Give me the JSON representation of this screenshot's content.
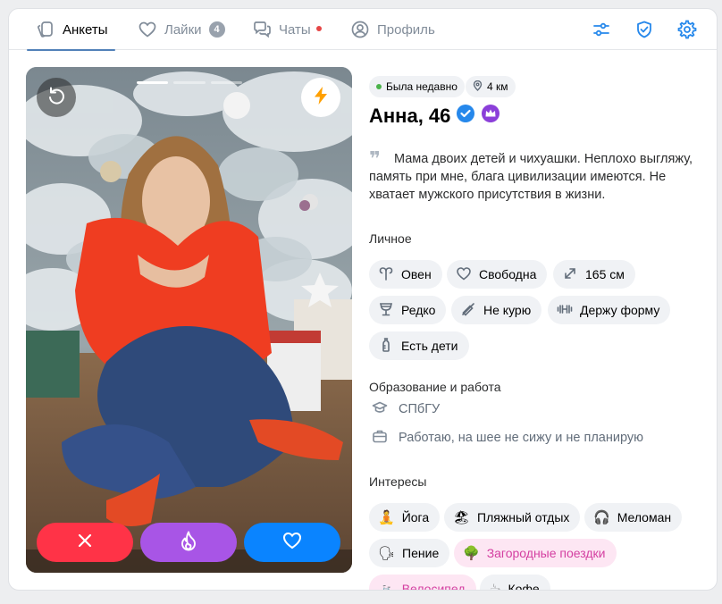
{
  "nav": {
    "tabs": [
      {
        "label": "Анкеты",
        "icon": "cards-icon",
        "active": true
      },
      {
        "label": "Лайки",
        "icon": "heart-icon",
        "badge": "4"
      },
      {
        "label": "Чаты",
        "icon": "chat-icon",
        "has_dot": true
      },
      {
        "label": "Профиль",
        "icon": "profile-icon"
      }
    ],
    "right_icons": [
      "filters-icon",
      "shield-check-icon",
      "settings-icon"
    ]
  },
  "photo": {
    "photo_count": 3,
    "current_photo": 1,
    "undo_icon": "undo-icon",
    "boost_icon": "lightning-icon",
    "actions": [
      {
        "name": "dislike-button",
        "icon": "close-icon",
        "color": "#ff3347"
      },
      {
        "name": "superlike-button",
        "icon": "fire-icon",
        "color": "#a855e6"
      },
      {
        "name": "like-button",
        "icon": "heart-icon",
        "color": "#0a84ff"
      }
    ]
  },
  "profile": {
    "status": "Была недавно",
    "status_color": "#4bb34b",
    "distance": "4 км",
    "name_age": "Анна, 46",
    "verified_color": "#2688eb",
    "premium_color": "#8b3fd9",
    "quote_mark": "❞",
    "about": "Мама двоих детей и чихуашки. Неплохо выгляжу, память при мне, блага цивилизации имеются. Не хватает мужского присутствия в жизни.",
    "personal_title": "Личное",
    "personal": [
      {
        "label": "Овен",
        "icon": "aries-icon"
      },
      {
        "label": "Свободна",
        "icon": "heart-outline-icon"
      },
      {
        "label": "165 см",
        "icon": "height-arrows-icon"
      },
      {
        "label": "Редко",
        "icon": "glass-icon"
      },
      {
        "label": "Не курю",
        "icon": "no-smoking-icon"
      },
      {
        "label": "Держу форму",
        "icon": "dumbbell-icon"
      },
      {
        "label": "Есть дети",
        "icon": "baby-bottle-icon"
      }
    ],
    "education_title": "Образование и работа",
    "education": {
      "label": "СПбГУ",
      "icon": "graduation-cap-icon"
    },
    "work": {
      "label": "Работаю, на шее не сижу и не планирую",
      "icon": "briefcase-icon"
    },
    "interests_title": "Интересы",
    "interests": [
      {
        "label": "Йога",
        "emoji": "🧘",
        "highlight": false
      },
      {
        "label": "Пляжный отдых",
        "emoji": "🏖",
        "highlight": false
      },
      {
        "label": "Меломан",
        "emoji": "🎧",
        "highlight": false
      },
      {
        "label": "Пение",
        "emoji": "🗣",
        "highlight": false
      },
      {
        "label": "Загородные поездки",
        "emoji": "🌳",
        "highlight": true
      },
      {
        "label": "Велосипед",
        "emoji": "🚲",
        "highlight": true
      },
      {
        "label": "Кофе",
        "emoji": "☕",
        "highlight": false
      }
    ]
  }
}
